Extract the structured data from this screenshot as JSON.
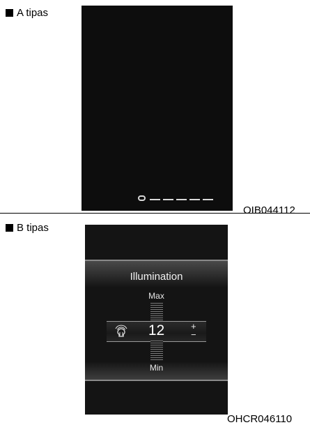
{
  "type_a": {
    "label": "A tipas",
    "figure_code": "OIB044112",
    "pager": {
      "current_page": 1,
      "total_pages": 6
    }
  },
  "type_b": {
    "label": "B tipas",
    "figure_code": "OHCR046110",
    "screen": {
      "title": "Illumination",
      "max_label": "Max",
      "min_label": "Min",
      "value": "12",
      "plus": "+",
      "minus": "−",
      "icon": "illumination-bulb-icon"
    }
  },
  "colors": {
    "panel_background": "#0d0d0d",
    "screen_text": "#f2f2f2"
  }
}
